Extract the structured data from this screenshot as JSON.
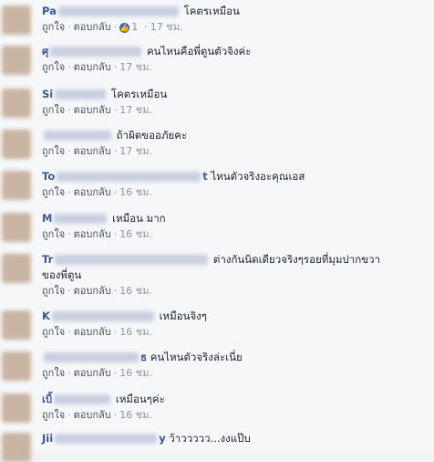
{
  "actions": {
    "like": "ถูกใจ",
    "reply": "ตอบกลับ",
    "sep": "·"
  },
  "comments": [
    {
      "name_start": "Pa",
      "text": "โคตรเหมือน",
      "time": "17 ชม.",
      "likes": "1"
    },
    {
      "name_start": "ศุ",
      "text": "คนไหนคือพี่ตูนตัวจิงค่ะ",
      "time": "17 ชม."
    },
    {
      "name_start": "Si",
      "text": "โคตรเหมือน",
      "time": "17 ชม."
    },
    {
      "name_start": "",
      "text": "ถ้าผิดขออภัยคะ",
      "time": "17 ชม."
    },
    {
      "name_start": "To",
      "name_end": "t",
      "text": "ไหนตัวจริงอะคุณเอส",
      "time": "16 ชม."
    },
    {
      "name_start": "M",
      "text": "เหมือน มาก",
      "time": "16 ชม."
    },
    {
      "name_start": "Tr",
      "text": "ต่างกันนิดเดียวจริงๆรอยที่มุมปากขวา",
      "text2": "ของพี่ตูน",
      "time": "16 ชม."
    },
    {
      "name_start": "K",
      "text": "เหมือนจิงๆ",
      "time": "16 ชม."
    },
    {
      "name_start": "",
      "name_end": "ธ",
      "text": "คนไหนตัวจริงล่ะเนี่ย",
      "time": "16 ชม."
    },
    {
      "name_start": "เบิ้",
      "text": "เหมือนๆค่ะ",
      "time": "16 ชม."
    },
    {
      "name_start": "Jii",
      "name_end": "y",
      "text": "ว้าววววว...งงแป๊บ"
    }
  ]
}
